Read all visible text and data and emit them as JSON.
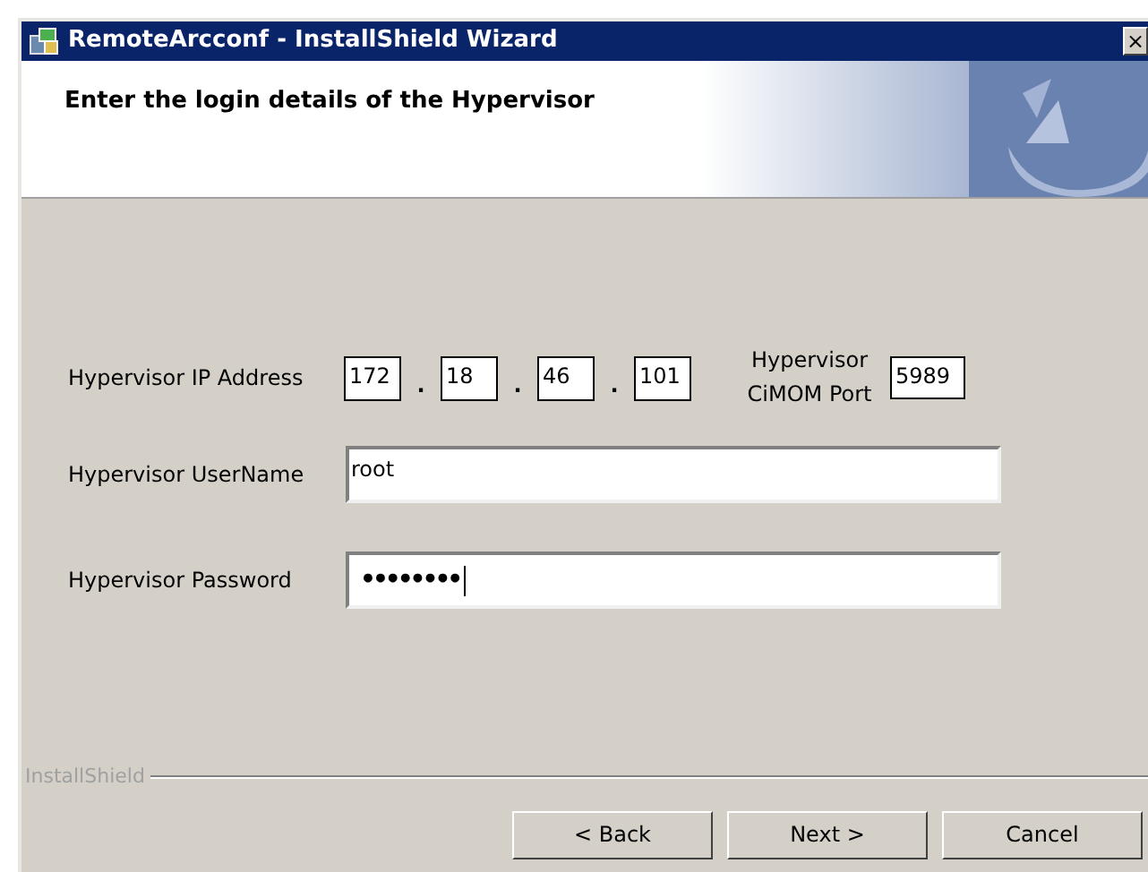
{
  "window": {
    "title": "RemoteArcconf - InstallShield Wizard",
    "close": "×"
  },
  "header": {
    "title": "Enter the login details of the Hypervisor"
  },
  "ip": {
    "label": "Hypervisor IP Address",
    "octets": [
      "172",
      "18",
      "46",
      "101"
    ],
    "separator": ".",
    "port_label": "Hypervisor CiMOM Port",
    "port": "5989"
  },
  "username": {
    "label": "Hypervisor UserName",
    "value": "root"
  },
  "password": {
    "label": "Hypervisor Password",
    "value": "••••••••",
    "focused": true
  },
  "footer": {
    "brand": "InstallShield"
  },
  "buttons": [
    {
      "label": "< Back"
    },
    {
      "label": "Next >"
    },
    {
      "label": "Cancel"
    }
  ]
}
